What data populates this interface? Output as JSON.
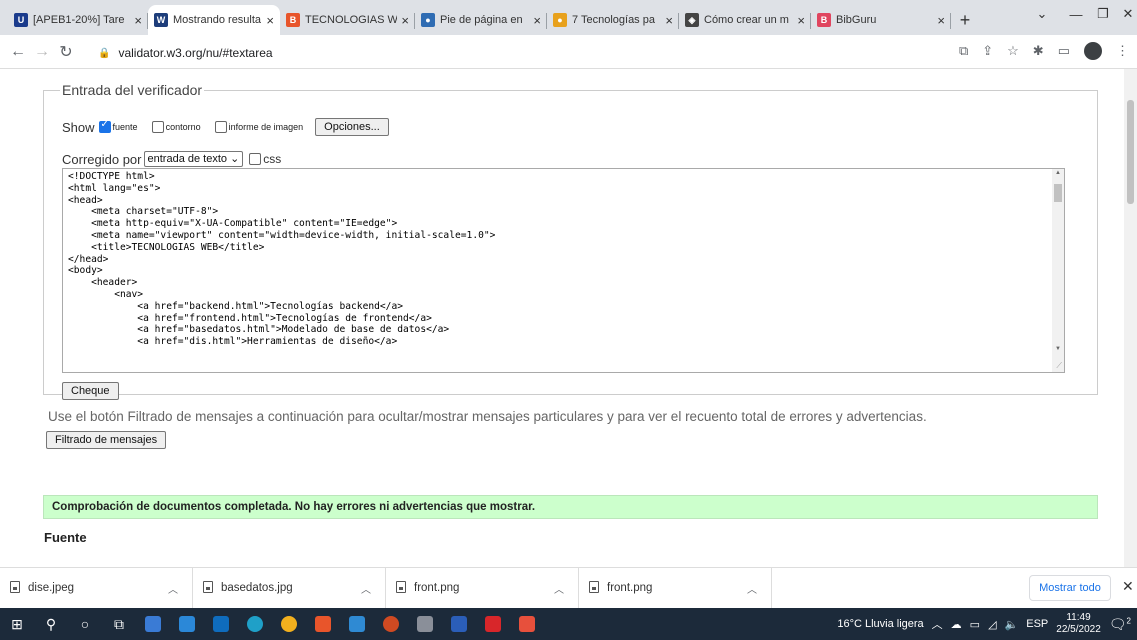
{
  "browser": {
    "tabs": [
      {
        "title": "[APEB1-20%] Tare",
        "fav": "U",
        "favcolor": "#1a3b8c",
        "active": false
      },
      {
        "title": "Mostrando resulta",
        "fav": "W",
        "favcolor": "#1d3d7a",
        "active": true
      },
      {
        "title": "TECNOLOGIAS W",
        "fav": "B",
        "favcolor": "#e8552b",
        "active": false
      },
      {
        "title": "Pie de página en",
        "fav": "●",
        "favcolor": "#2f6cb3",
        "active": false
      },
      {
        "title": "7 Tecnologías pa",
        "fav": "●",
        "favcolor": "#e8a11c",
        "active": false
      },
      {
        "title": "Cómo crear un m",
        "fav": "◈",
        "favcolor": "#444444",
        "active": false
      },
      {
        "title": "BibGuru",
        "fav": "B",
        "favcolor": "#e0455f",
        "active": false
      }
    ],
    "url": "validator.w3.org/nu/#textarea"
  },
  "validator": {
    "legend": "Entrada del verificador",
    "show_label": "Show",
    "opt_fuente": "fuente",
    "opt_contorno": "contorno",
    "opt_informe": "informe de imagen",
    "options_button": "Opciones...",
    "checked_by_label": "Corregido por",
    "checked_by_value": "entrada de texto",
    "css_label": "css",
    "source": "<!DOCTYPE html>\n<html lang=\"es\">\n<head>\n    <meta charset=\"UTF-8\">\n    <meta http-equiv=\"X-UA-Compatible\" content=\"IE=edge\">\n    <meta name=\"viewport\" content=\"width=device-width, initial-scale=1.0\">\n    <title>TECNOLOGIAS WEB</title>\n</head>\n<body>\n    <header>\n        <nav>\n            <a href=\"backend.html\">Tecnologías backend</a>\n            <a href=\"frontend.html\">Tecnologías de frontend</a>\n            <a href=\"basedatos.html\">Modelado de base de datos</a>\n            <a href=\"dis.html\">Herramientas de diseño</a>",
    "check_button": "Cheque",
    "hint": "Use el botón Filtrado de mensajes a continuación para ocultar/mostrar mensajes particulares y para ver el recuento total de errores y advertencias.",
    "filter_button": "Filtrado de mensajes",
    "success": "Comprobación de documentos completada. No hay errores ni advertencias que mostrar.",
    "source_heading": "Fuente"
  },
  "downloads": {
    "items": [
      "dise.jpeg",
      "basedatos.jpg",
      "front.png",
      "front.png"
    ],
    "show_all": "Mostrar todo"
  },
  "taskbar": {
    "weather": "16°C  Lluvia ligera",
    "lang": "ESP",
    "time": "11:49",
    "date": "22/5/2022",
    "notif_count": "2"
  }
}
